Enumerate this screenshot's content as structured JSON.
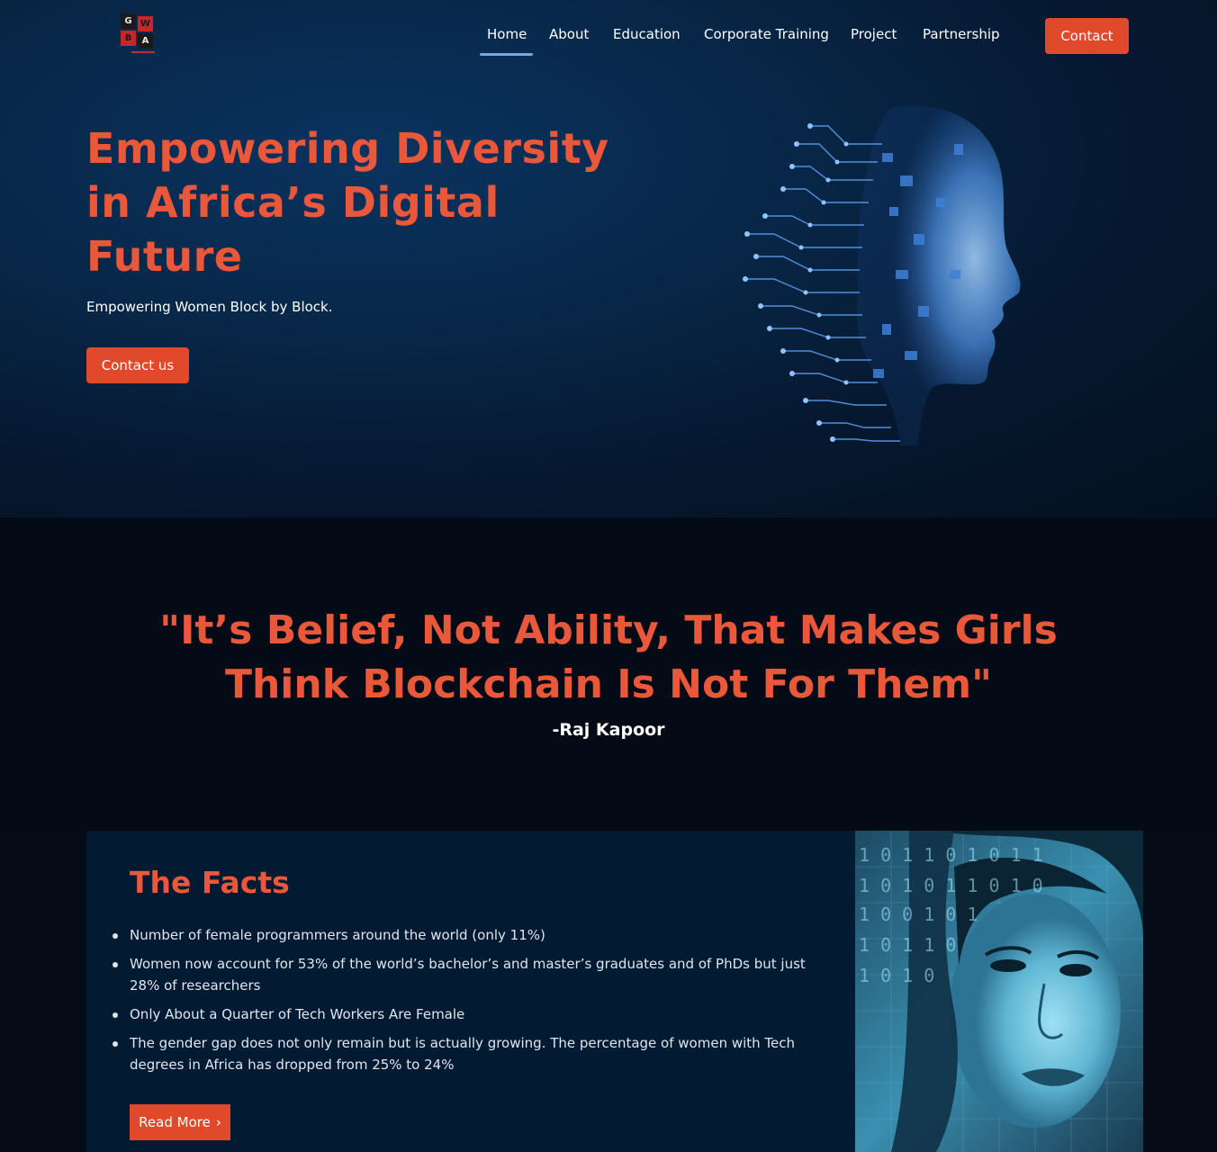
{
  "logo": {
    "letters": [
      "G",
      "W",
      "B",
      "A"
    ],
    "alt": "GWBA logo"
  },
  "nav": {
    "items": [
      {
        "label": "Home",
        "active": true
      },
      {
        "label": "About"
      },
      {
        "label": "Education"
      },
      {
        "label": "Corporate Training"
      },
      {
        "label": "Project"
      },
      {
        "label": "Partnership"
      }
    ],
    "contact_button": "Contact"
  },
  "hero": {
    "title_lines": [
      "Empowering Diversity",
      "in Africa’s Digital",
      "Future"
    ],
    "subtitle": "Empowering Women Block by Block.",
    "cta": "Contact us",
    "image": "digital-head-illustration"
  },
  "quote": {
    "line1": "\"It’s Belief, Not Ability, That Makes Girls",
    "line2": "Think Blockchain Is Not For Them\"",
    "author": "-Raj Kapoor"
  },
  "facts": {
    "title": "The Facts",
    "items": [
      "Number of female programmers around the world (only 11%)",
      "Women now account for 53% of the world’s bachelor’s and master’s graduates and of PhDs but just 28% of researchers",
      "Only About a Quarter of Tech Workers Are Female",
      "The gender gap does not only remain but is actually growing. The percentage of women with Tech degrees in Africa has dropped from 25% to 24%"
    ],
    "read_more": "Read More",
    "read_more_icon": "chevron-right-icon",
    "image": "woman-binary-portrait"
  },
  "colors": {
    "accent": "#e0492a",
    "heading": "#e9583a",
    "nav_active_underline": "#7aa6e0",
    "hero_bg": "#082748",
    "facts_bg": "#031a33",
    "page_bg": "#040b16"
  }
}
